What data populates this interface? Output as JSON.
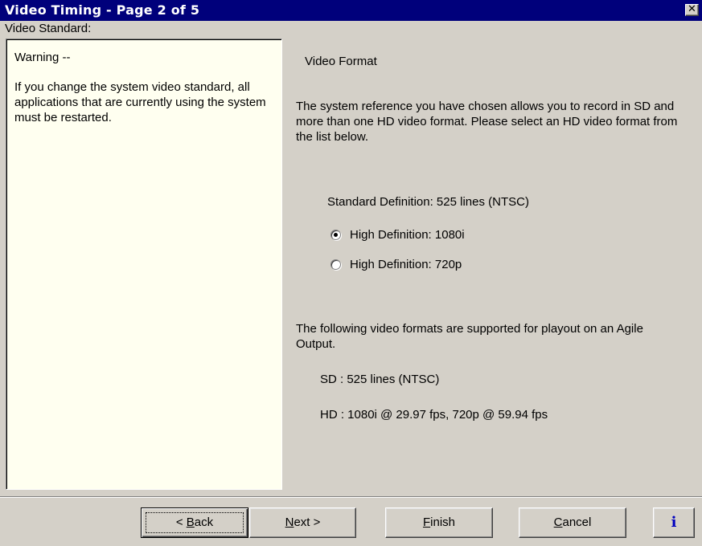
{
  "window": {
    "title": "Video Timing - Page 2 of 5",
    "close_glyph": "✕"
  },
  "section_label": "Video Standard:",
  "warning": {
    "title": "Warning --",
    "body": "If you change the system video standard, all applications that are currently using the system must be restarted."
  },
  "format": {
    "title": "Video Format",
    "intro": "The system reference you have chosen allows you to record in SD and more than one HD video format. Please select an HD video format from the list below.",
    "standard_definition": "Standard Definition: 525 lines (NTSC)",
    "options": [
      {
        "label": "High Definition: 1080i",
        "selected": true
      },
      {
        "label": "High Definition: 720p",
        "selected": false
      }
    ],
    "playout_text": "The following video formats are supported for playout on an Agile Output.",
    "sd_line": "SD : 525 lines (NTSC)",
    "hd_line": "HD : 1080i @ 29.97 fps, 720p @ 59.94 fps"
  },
  "buttons": {
    "back": {
      "prefix": "< ",
      "accel": "B",
      "rest": "ack"
    },
    "next": {
      "accel": "N",
      "rest": "ext >"
    },
    "finish": {
      "accel": "F",
      "rest": "inish"
    },
    "cancel": {
      "accel": "C",
      "rest": "ancel"
    },
    "info": "i"
  },
  "colors": {
    "title_bar": "#00007b",
    "dialog_bg": "#d4d0c8",
    "warning_bg": "#fffff0",
    "info_icon": "#0000c0"
  }
}
